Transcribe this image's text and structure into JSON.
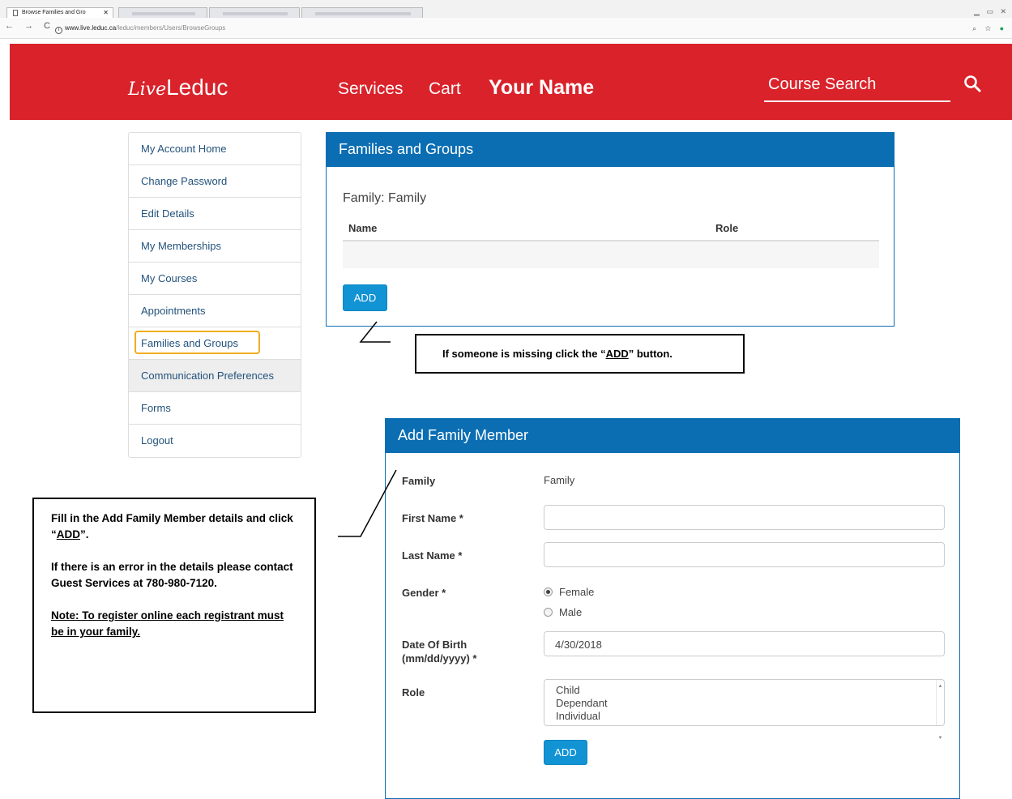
{
  "browser": {
    "active_tab_title": "Browse Families and Gro",
    "url_host": "www.live.leduc.ca",
    "url_path": "/leduc/members/Users/BrowseGroups"
  },
  "header": {
    "logo_script": "Live",
    "logo_text": "Leduc",
    "nav_services": "Services",
    "nav_cart": "Cart",
    "user_name": "Your Name",
    "search_placeholder": "Course Search",
    "color": "#d9222a"
  },
  "sidebar": {
    "items": [
      {
        "label": "My Account Home"
      },
      {
        "label": "Change Password"
      },
      {
        "label": "Edit Details"
      },
      {
        "label": "My Memberships"
      },
      {
        "label": "My Courses"
      },
      {
        "label": "Appointments"
      },
      {
        "label": "Families and Groups",
        "active": true
      },
      {
        "label": "Communication Preferences"
      },
      {
        "label": "Forms"
      },
      {
        "label": "Logout"
      }
    ]
  },
  "families_panel": {
    "title": "Families and Groups",
    "family_label": "Family: Family",
    "columns": [
      "Name",
      "Role"
    ],
    "add_button": "ADD"
  },
  "add_member_panel": {
    "title": "Add Family Member",
    "family_label": "Family",
    "family_value": "Family",
    "first_name_label": "First Name *",
    "first_name_value": "",
    "last_name_label": "Last Name *",
    "last_name_value": "",
    "gender_label": "Gender *",
    "gender_options": [
      "Female",
      "Male"
    ],
    "gender_selected": "Female",
    "dob_label_line1": "Date Of Birth",
    "dob_label_line2": "(mm/dd/yyyy) *",
    "dob_value": "4/30/2018",
    "role_label": "Role",
    "role_options": [
      "Child",
      "Dependant",
      "Individual"
    ],
    "add_button": "ADD"
  },
  "callouts": {
    "top_pre": "If someone is missing click the “",
    "top_key": "ADD",
    "top_post": "” button.",
    "left_p1_pre": "Fill in the Add Family Member details and click “",
    "left_p1_key": "ADD",
    "left_p1_post": "”.",
    "left_p2": "If there is an error in the details please contact Guest Services at 780-980-7120.",
    "left_note": "Note: To register online each registrant must be in your family."
  },
  "colors": {
    "panel_blue": "#0b6eb3",
    "button_blue": "#1193d4",
    "active_highlight": "#f0ad1e"
  }
}
